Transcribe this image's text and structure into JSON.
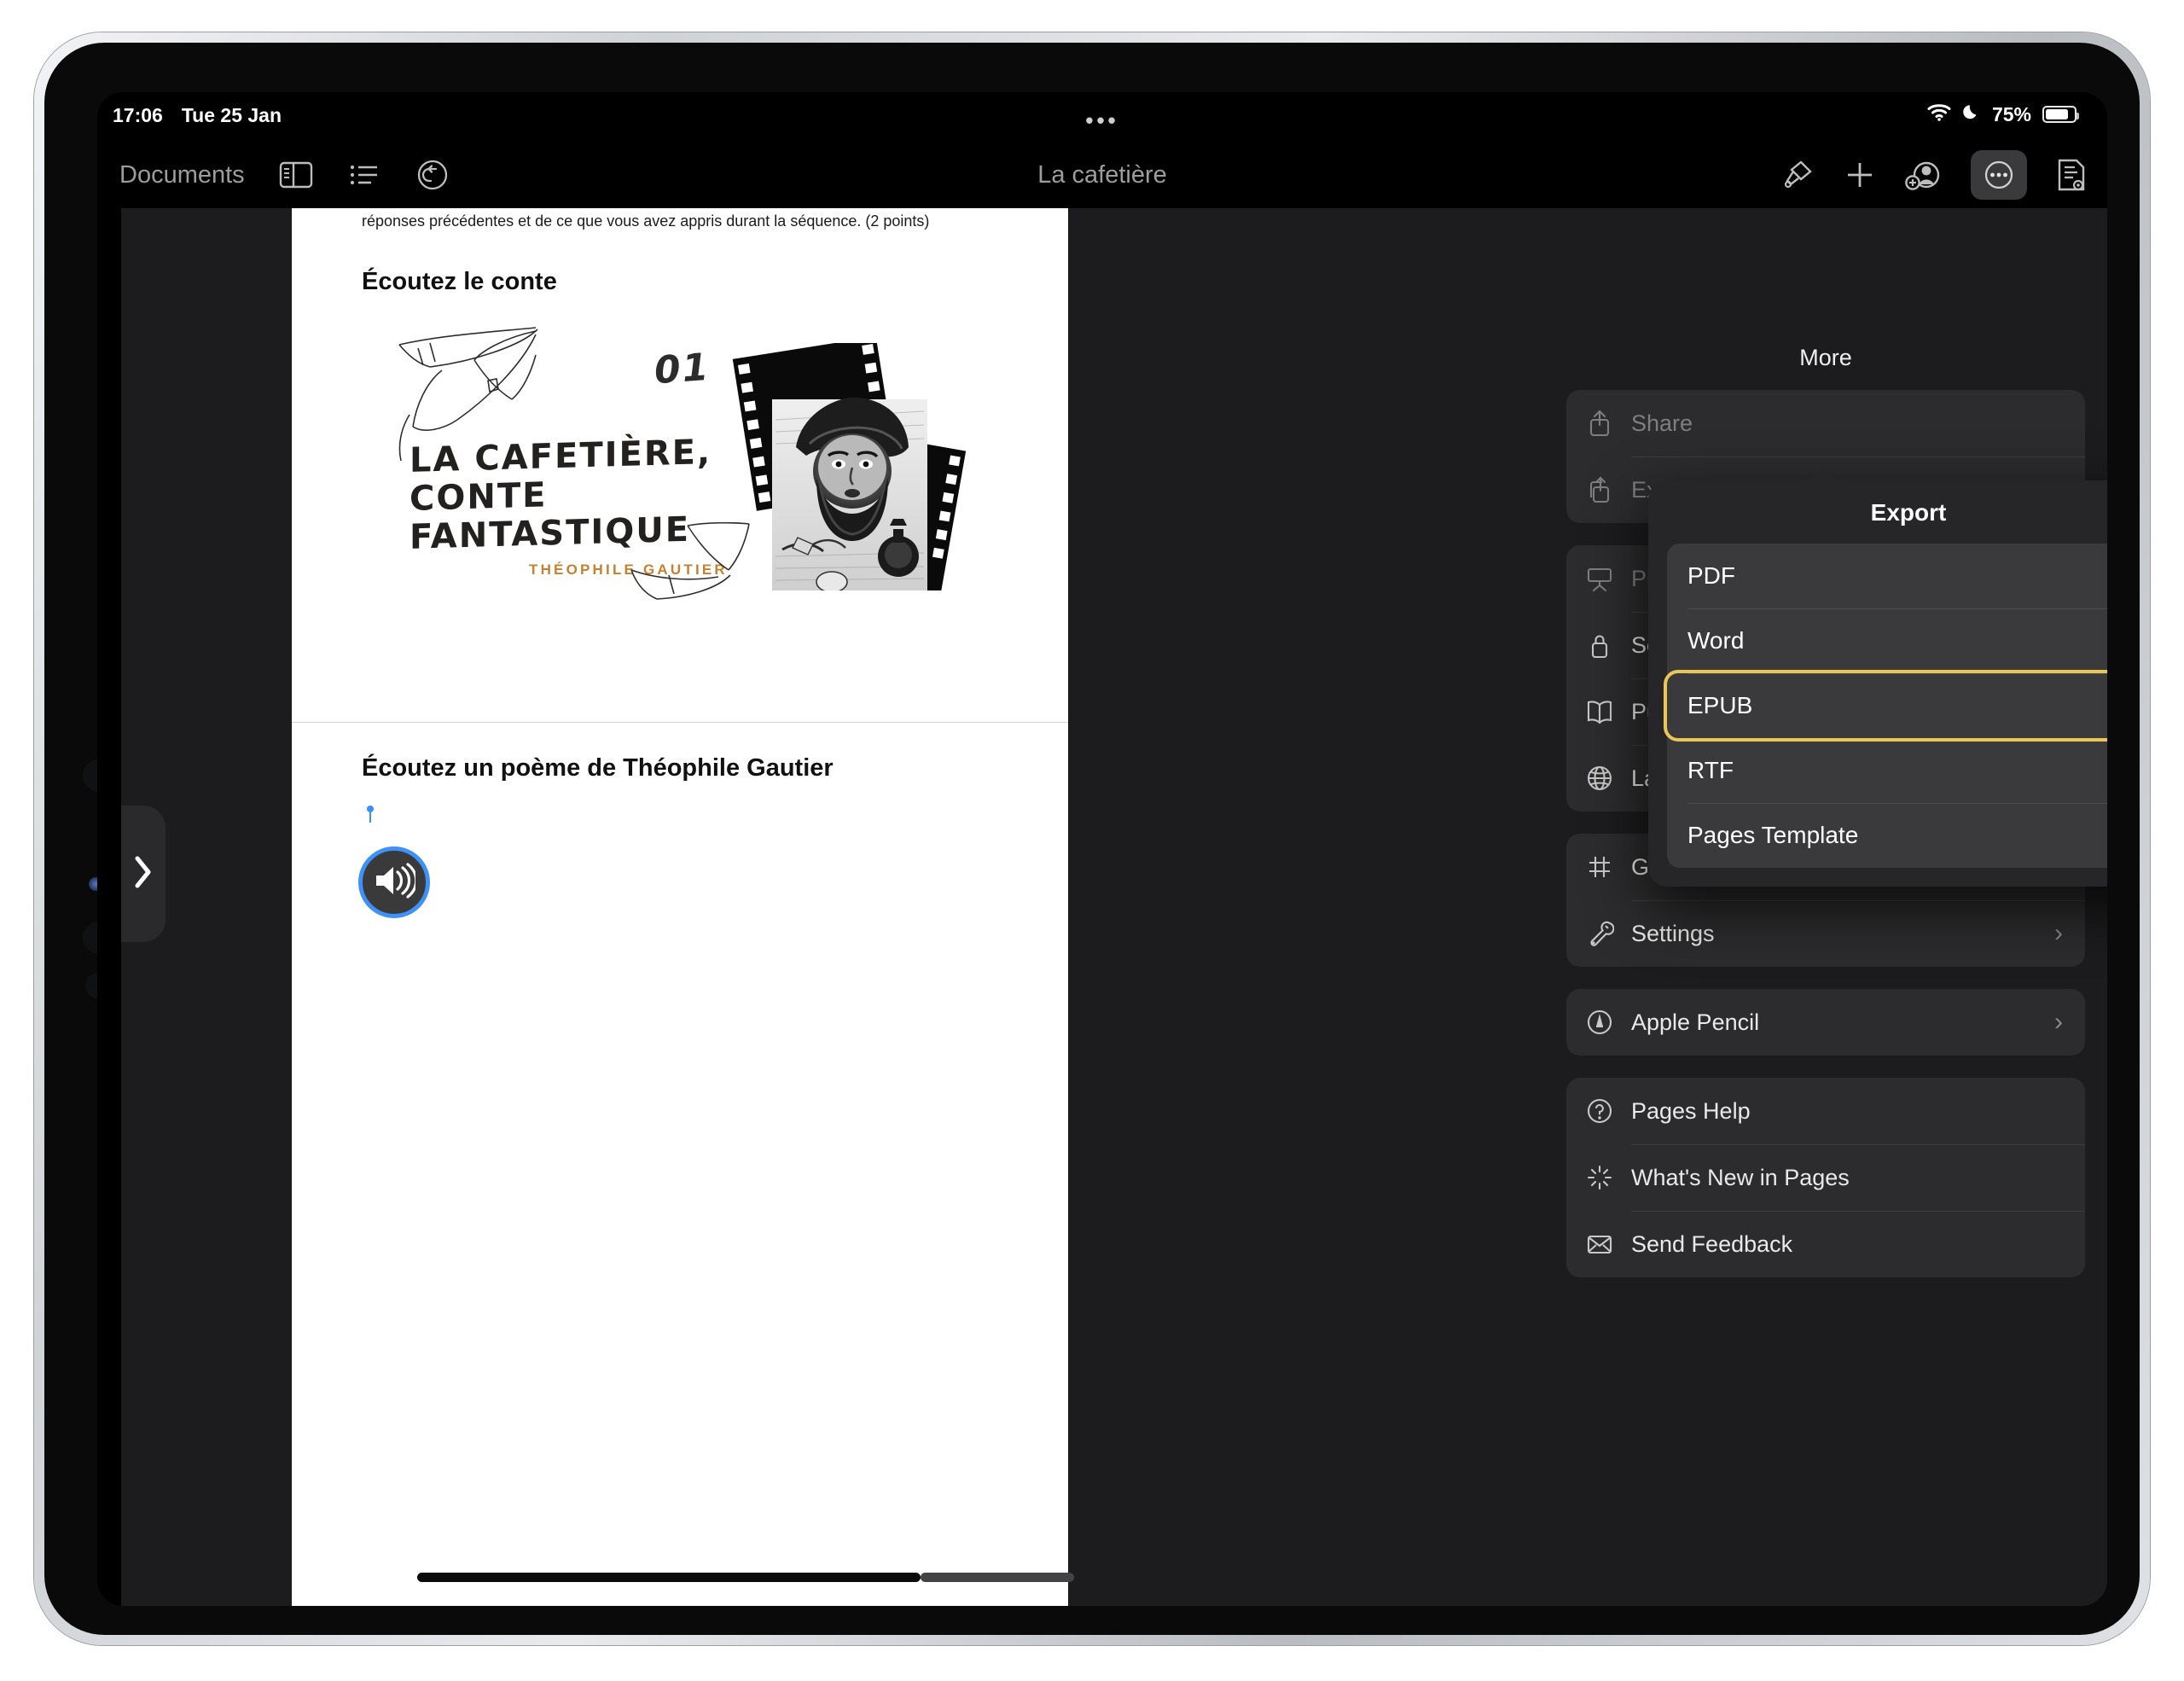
{
  "status_bar": {
    "time": "17:06",
    "date": "Tue 25 Jan",
    "center_dots": "•••",
    "battery_percent": "75%",
    "wifi_icon": "wifi-icon",
    "dnd_icon": "moon-icon",
    "battery_icon": "battery-icon"
  },
  "toolbar": {
    "back_label": "Documents",
    "doc_title": "La cafetière",
    "icons": [
      {
        "name": "sidebar-icon"
      },
      {
        "name": "list-view-icon"
      },
      {
        "name": "undo-icon"
      },
      {
        "name": "format-brush-icon"
      },
      {
        "name": "insert-plus-icon"
      },
      {
        "name": "add-collaborator-icon"
      },
      {
        "name": "more-ellipsis-icon"
      },
      {
        "name": "document-view-icon"
      }
    ]
  },
  "document": {
    "partial_text": "réponses précédentes et de ce que vous avez appris durant la séquence. (2 points)",
    "heading_1": "Écoutez le conte",
    "heading_2": "Écoutez un poème de Théophile Gautier",
    "illustration": {
      "number": "01",
      "title_line_1": "LA CAFETIÈRE,",
      "title_line_2": "CONTE",
      "title_line_3": "FANTASTIQUE",
      "author": "THÉOPHILE GAUTIER",
      "author_color": "#c4812f"
    },
    "audio_button_icon": "speaker-wave-icon",
    "audio_accent_color": "#3e91f7"
  },
  "more_panel": {
    "title": "More",
    "groups": [
      {
        "rows": [
          {
            "label": "Share",
            "icon": "share-icon",
            "chevron": "",
            "dimmed": true
          },
          {
            "label": "Export",
            "icon": "export-share-icon",
            "chevron": "›",
            "dimmed": true
          }
        ]
      },
      {
        "rows": [
          {
            "label": "Presenter Mode",
            "icon": "presenter-screen-icon",
            "chevron": "",
            "dimmed": true
          },
          {
            "label": "Set Password",
            "icon": "lock-icon",
            "chevron": "",
            "dimmed": false
          },
          {
            "label": "Publish to Apple Books",
            "icon": "book-icon",
            "chevron": "",
            "dimmed": false
          },
          {
            "label": "Language & Region",
            "icon": "globe-icon",
            "chevron": "",
            "dimmed": false
          }
        ]
      },
      {
        "rows": [
          {
            "label": "Guides",
            "icon": "grid-hash-icon",
            "chevron": "›",
            "dimmed": false
          },
          {
            "label": "Settings",
            "icon": "wrench-icon",
            "chevron": "›",
            "dimmed": false
          }
        ]
      },
      {
        "rows": [
          {
            "label": "Apple Pencil",
            "icon": "apple-pencil-icon",
            "chevron": "›",
            "dimmed": false
          }
        ]
      },
      {
        "rows": [
          {
            "label": "Pages Help",
            "icon": "question-circle-icon",
            "chevron": "",
            "dimmed": false
          },
          {
            "label": "What's New in Pages",
            "icon": "sparkle-icon",
            "chevron": "",
            "dimmed": false
          },
          {
            "label": "Send Feedback",
            "icon": "envelope-icon",
            "chevron": "",
            "dimmed": false
          }
        ]
      }
    ]
  },
  "export_popover": {
    "title": "Export",
    "options": [
      {
        "label": "PDF",
        "selected": false
      },
      {
        "label": "Word",
        "selected": false
      },
      {
        "label": "EPUB",
        "selected": true
      },
      {
        "label": "RTF",
        "selected": false
      },
      {
        "label": "Pages Template",
        "selected": false
      }
    ],
    "highlight_color": "#e8c657"
  },
  "sidebar_handle": {
    "icon": "chevron-right-icon"
  }
}
